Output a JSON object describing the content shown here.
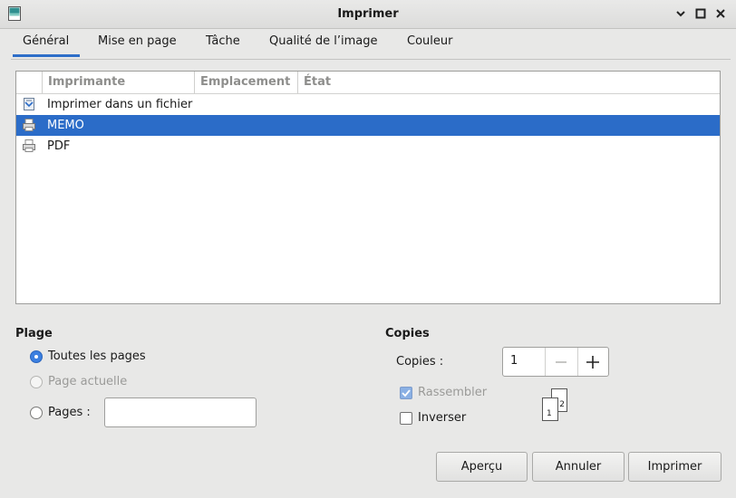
{
  "window": {
    "title": "Imprimer"
  },
  "tabs": [
    {
      "label": "Général",
      "active": true
    },
    {
      "label": "Mise en page"
    },
    {
      "label": "Tâche"
    },
    {
      "label": "Qualité de l’image"
    },
    {
      "label": "Couleur"
    }
  ],
  "printers": {
    "columns": [
      "Imprimante",
      "Emplacement",
      "État"
    ],
    "rows": [
      {
        "name": "Imprimer dans un fichier",
        "icon": "print-to-file-icon"
      },
      {
        "name": "MEMO",
        "icon": "printer-icon",
        "selected": true
      },
      {
        "name": "PDF",
        "icon": "printer-icon"
      }
    ]
  },
  "range": {
    "heading": "Plage",
    "all_pages": "Toutes les pages",
    "current_page": "Page actuelle",
    "pages": "Pages :",
    "pages_value": ""
  },
  "copies": {
    "heading": "Copies",
    "label": "Copies :",
    "value": "1",
    "collate": "Rassembler",
    "reverse": "Inverser",
    "collate_preview": [
      "1",
      "2"
    ]
  },
  "buttons": {
    "preview": "Aperçu",
    "cancel": "Annuler",
    "print": "Imprimer"
  },
  "colors": {
    "accent": "#2b6cc8"
  }
}
